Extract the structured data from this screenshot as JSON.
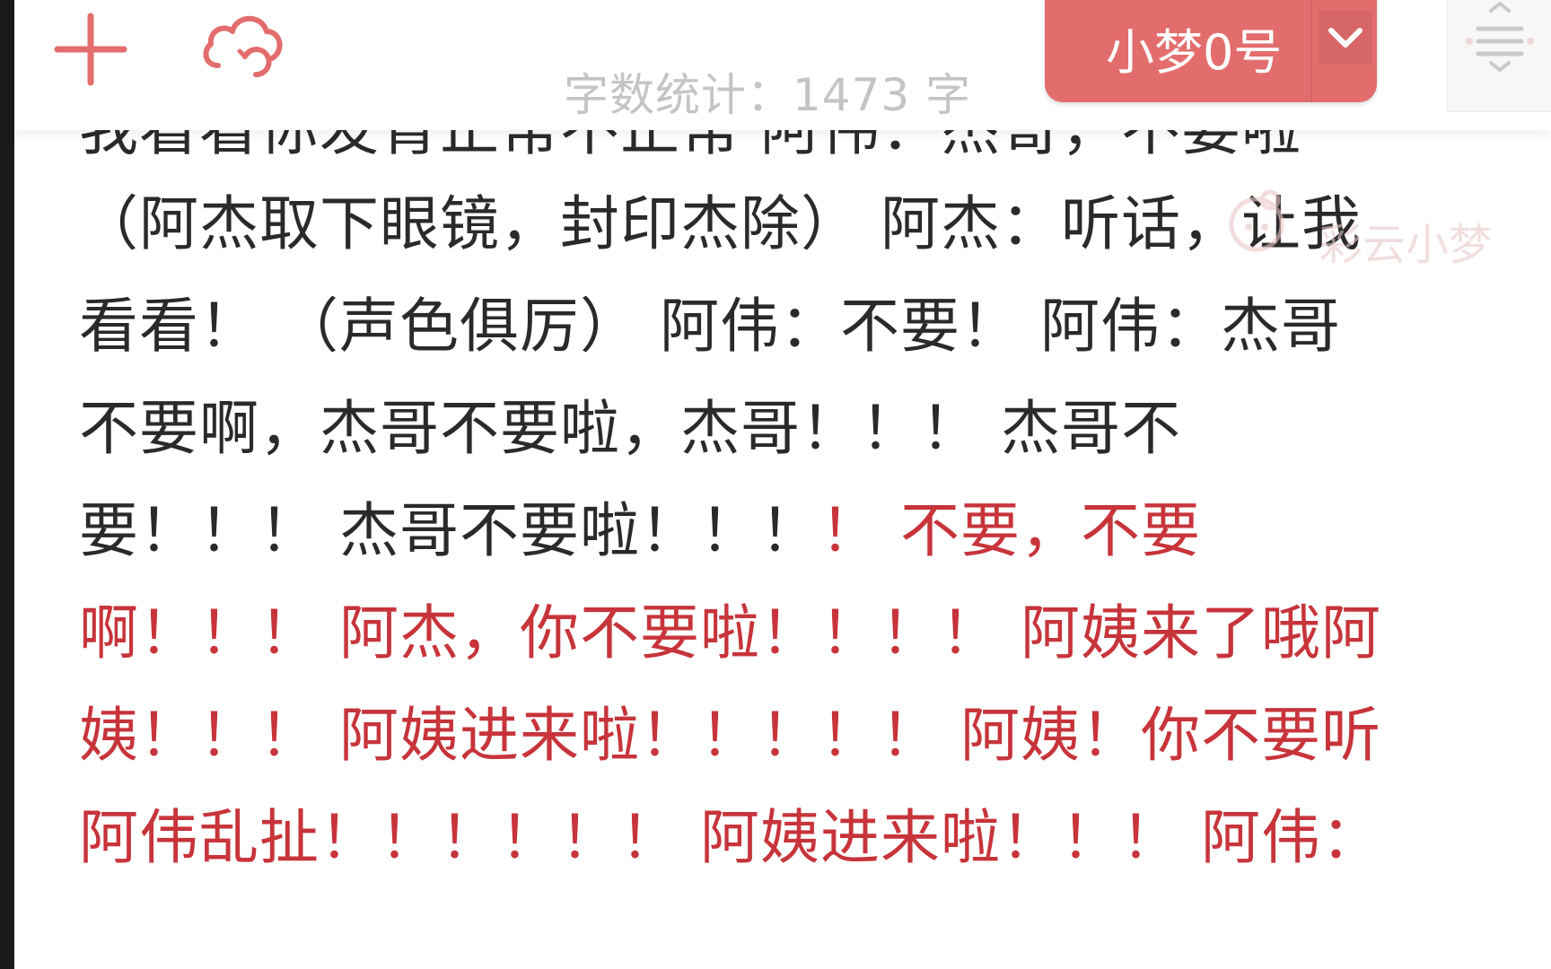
{
  "toolbar": {
    "word_count": "字数统计：1473 字",
    "dictionary_label": "小梦0号",
    "add_icon": "plus-icon",
    "cloud_icon": "cloud-sync-icon",
    "menu_icon": "menu-lines-icon",
    "accent_color": "#e36d6d"
  },
  "watermark": {
    "text": "彩云小梦"
  },
  "document": {
    "lines": [
      {
        "segments": [
          {
            "text": "我看看你发育正常不正常 阿伟：杰哥，不要啦",
            "red": false
          }
        ]
      },
      {
        "segments": [
          {
            "text": "（阿杰取下眼镜，封印杰除） 阿杰：听话，让我",
            "red": false
          }
        ]
      },
      {
        "segments": [
          {
            "text": "看看！ （声色俱厉） 阿伟：不要！ 阿伟：杰哥",
            "red": false
          }
        ]
      },
      {
        "segments": [
          {
            "text": "不要啊，杰哥不要啦，杰哥！！！ 杰哥不",
            "red": false
          }
        ]
      },
      {
        "segments": [
          {
            "text": "要！！！ 杰哥不要啦！！！",
            "red": false
          },
          {
            "text": "！ 不要，不要",
            "red": true
          }
        ]
      },
      {
        "segments": [
          {
            "text": "啊！！！ 阿杰，你不要啦！！！！ 阿姨来了哦阿",
            "red": true
          }
        ]
      },
      {
        "segments": [
          {
            "text": "姨！！！ 阿姨进来啦！！！！！ 阿姨！你不要听",
            "red": true
          }
        ]
      },
      {
        "segments": [
          {
            "text": "阿伟乱扯！！！！！！ 阿姨进来啦！！！ 阿伟：",
            "red": true
          }
        ]
      }
    ]
  }
}
